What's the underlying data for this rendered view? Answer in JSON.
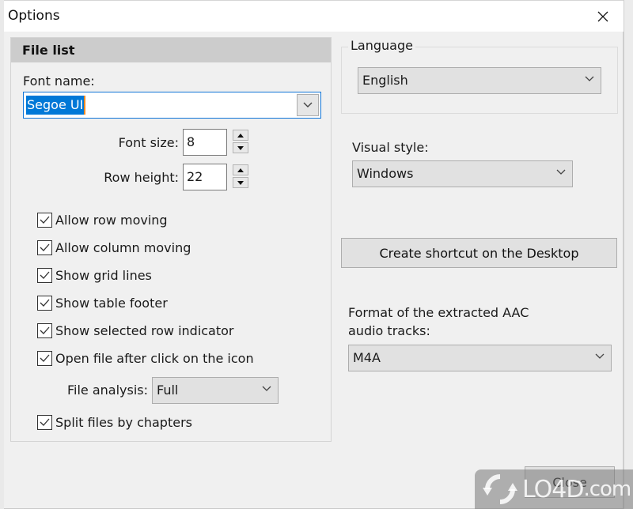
{
  "window": {
    "title": "Options",
    "close_icon": "close-x-icon"
  },
  "file_list": {
    "header": "File list",
    "font_name_label": "Font name:",
    "font_name_value": "Segoe UI",
    "font_size_label": "Font size:",
    "font_size_value": "8",
    "row_height_label": "Row height:",
    "row_height_value": "22",
    "checkboxes": [
      {
        "label": "Allow row moving",
        "checked": true
      },
      {
        "label": "Allow column moving",
        "checked": true
      },
      {
        "label": "Show grid lines",
        "checked": true
      },
      {
        "label": "Show table footer",
        "checked": true
      },
      {
        "label": "Show selected row indicator",
        "checked": true
      },
      {
        "label": "Open file after click on the icon",
        "checked": true
      }
    ],
    "file_analysis_label": "File analysis:",
    "file_analysis_value": "Full",
    "split_files": {
      "label": "Split files by chapters",
      "checked": true
    }
  },
  "language": {
    "group_label": "Language",
    "value": "English"
  },
  "visual_style": {
    "label": "Visual style:",
    "value": "Windows"
  },
  "shortcut_button": "Create shortcut on the Desktop",
  "aac_format": {
    "label_line1": "Format of the extracted AAC",
    "label_line2": "audio tracks:",
    "value": "M4A"
  },
  "close_button": "Close",
  "watermark": {
    "text": "LO4D",
    "suffix": ".com"
  },
  "colors": {
    "selection": "#0078d7",
    "focus_border": "#0f74d6",
    "header_bg": "#cccccc",
    "dialog_bg": "#f0f0f0"
  }
}
